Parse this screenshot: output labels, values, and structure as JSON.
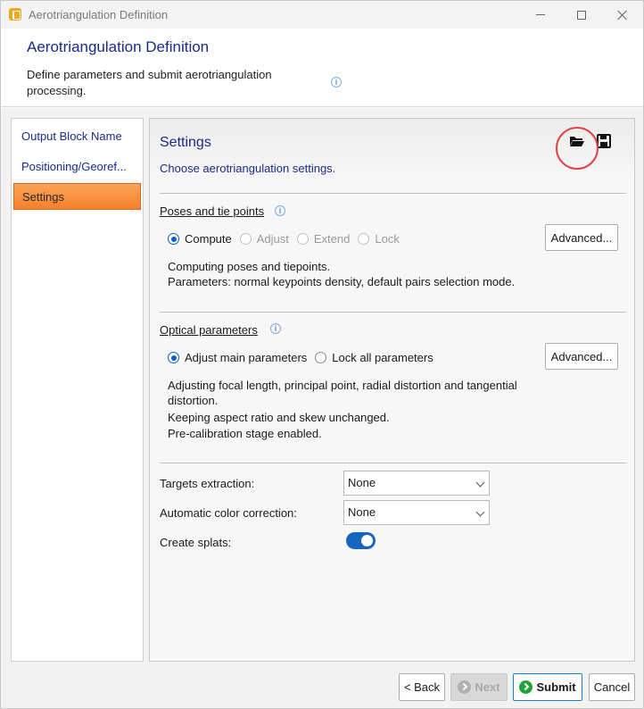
{
  "window": {
    "title": "Aerotriangulation Definition"
  },
  "header": {
    "title": "Aerotriangulation Definition",
    "description": "Define parameters and submit aerotriangulation processing."
  },
  "sidebar": {
    "items": [
      {
        "label": "Output Block Name",
        "active": false
      },
      {
        "label": "Positioning/Georef...",
        "active": false
      },
      {
        "label": "Settings",
        "active": true
      }
    ]
  },
  "panel": {
    "title": "Settings",
    "subtitle": "Choose aerotriangulation settings.",
    "icons": [
      "open-folder-icon",
      "save-disk-icon"
    ]
  },
  "poses": {
    "label": "Poses and tie points",
    "options": [
      "Compute",
      "Adjust",
      "Extend",
      "Lock"
    ],
    "selected": "Compute",
    "advanced_label": "Advanced...",
    "desc_line1": "Computing poses and tiepoints.",
    "desc_line2": "Parameters: normal keypoints density, default pairs selection mode."
  },
  "optical": {
    "label": "Optical parameters",
    "options": [
      "Adjust main parameters",
      "Lock all parameters"
    ],
    "selected": "Adjust main parameters",
    "advanced_label": "Advanced...",
    "desc_line1": "Adjusting focal length, principal point, radial distortion and tangential",
    "desc_line2": "distortion.",
    "desc_line3": "Keeping aspect ratio and skew unchanged.",
    "desc_line4": "Pre-calibration stage enabled."
  },
  "targets": {
    "label": "Targets extraction:",
    "value": "None"
  },
  "color_correction": {
    "label": "Automatic color correction:",
    "value": "None"
  },
  "splats": {
    "label": "Create splats:",
    "enabled": true
  },
  "footer": {
    "back_label": "< Back",
    "next_label": "Next",
    "submit_label": "Submit",
    "cancel_label": "Cancel"
  },
  "colors": {
    "accent_blue": "#1a2a8a",
    "active_tab": "#f6812a",
    "toggle_on": "#1565c0",
    "highlight_ring": "#e0424a",
    "submit_green": "#22a33a"
  }
}
